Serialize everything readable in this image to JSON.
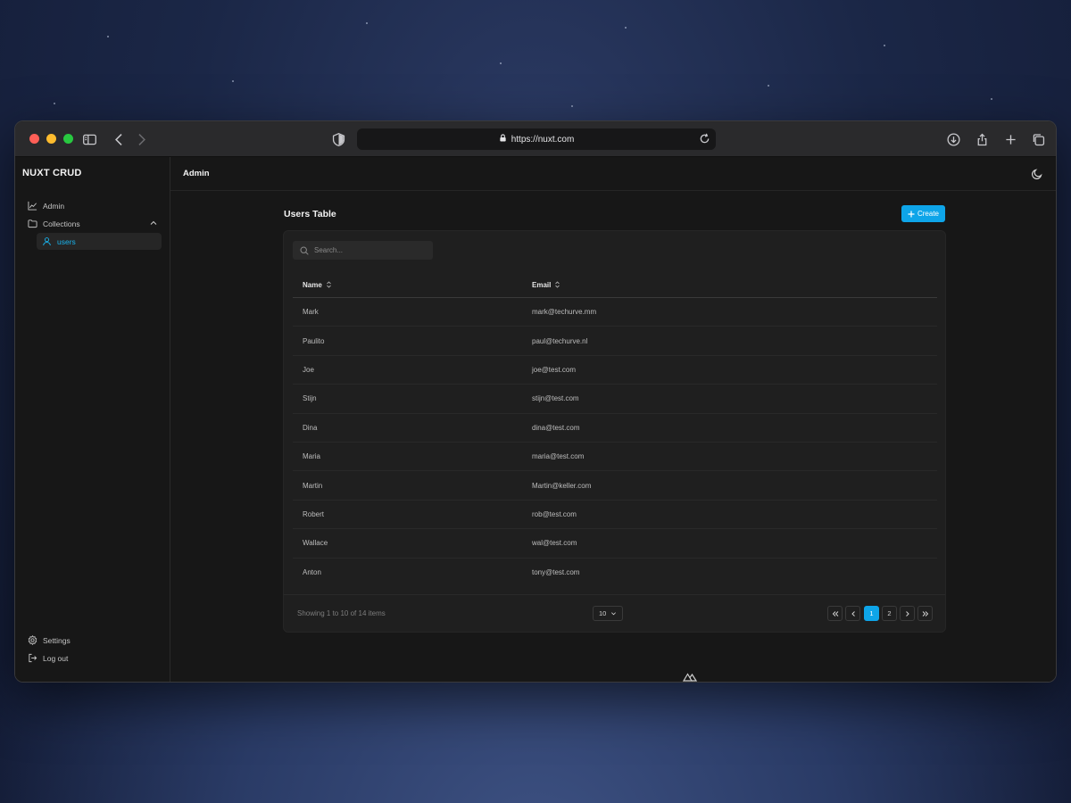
{
  "browser": {
    "url": "https://nuxt.com"
  },
  "sidebar": {
    "brand": "NUXT CRUD",
    "items": [
      {
        "label": "Admin"
      },
      {
        "label": "Collections"
      },
      {
        "label": "users"
      }
    ],
    "bottom": [
      {
        "label": "Settings"
      },
      {
        "label": "Log out"
      }
    ]
  },
  "topbar": {
    "title": "Admin"
  },
  "page": {
    "title": "Users Table",
    "create_label": "Create"
  },
  "search": {
    "placeholder": "Search..."
  },
  "table": {
    "headers": [
      "Name",
      "Email"
    ],
    "rows": [
      {
        "name": "Mark",
        "email": "mark@techurve.mm"
      },
      {
        "name": "Paulito",
        "email": "paul@techurve.nl"
      },
      {
        "name": "Joe",
        "email": "joe@test.com"
      },
      {
        "name": "Stijn",
        "email": "stijn@test.com"
      },
      {
        "name": "Dina",
        "email": "dina@test.com"
      },
      {
        "name": "Maria",
        "email": "maria@test.com"
      },
      {
        "name": "Martin",
        "email": "Martin@keller.com"
      },
      {
        "name": "Robert",
        "email": "rob@test.com"
      },
      {
        "name": "Wallace",
        "email": "wal@test.com"
      },
      {
        "name": "Anton",
        "email": "tony@test.com"
      }
    ]
  },
  "footer": {
    "showing": "Showing 1 to 10 of 14 items",
    "per_page": "10",
    "pages": [
      "1",
      "2"
    ],
    "active_page": "1"
  },
  "colors": {
    "accent": "#0ea5e9",
    "background": "#171717",
    "card": "#1f1f1f"
  }
}
